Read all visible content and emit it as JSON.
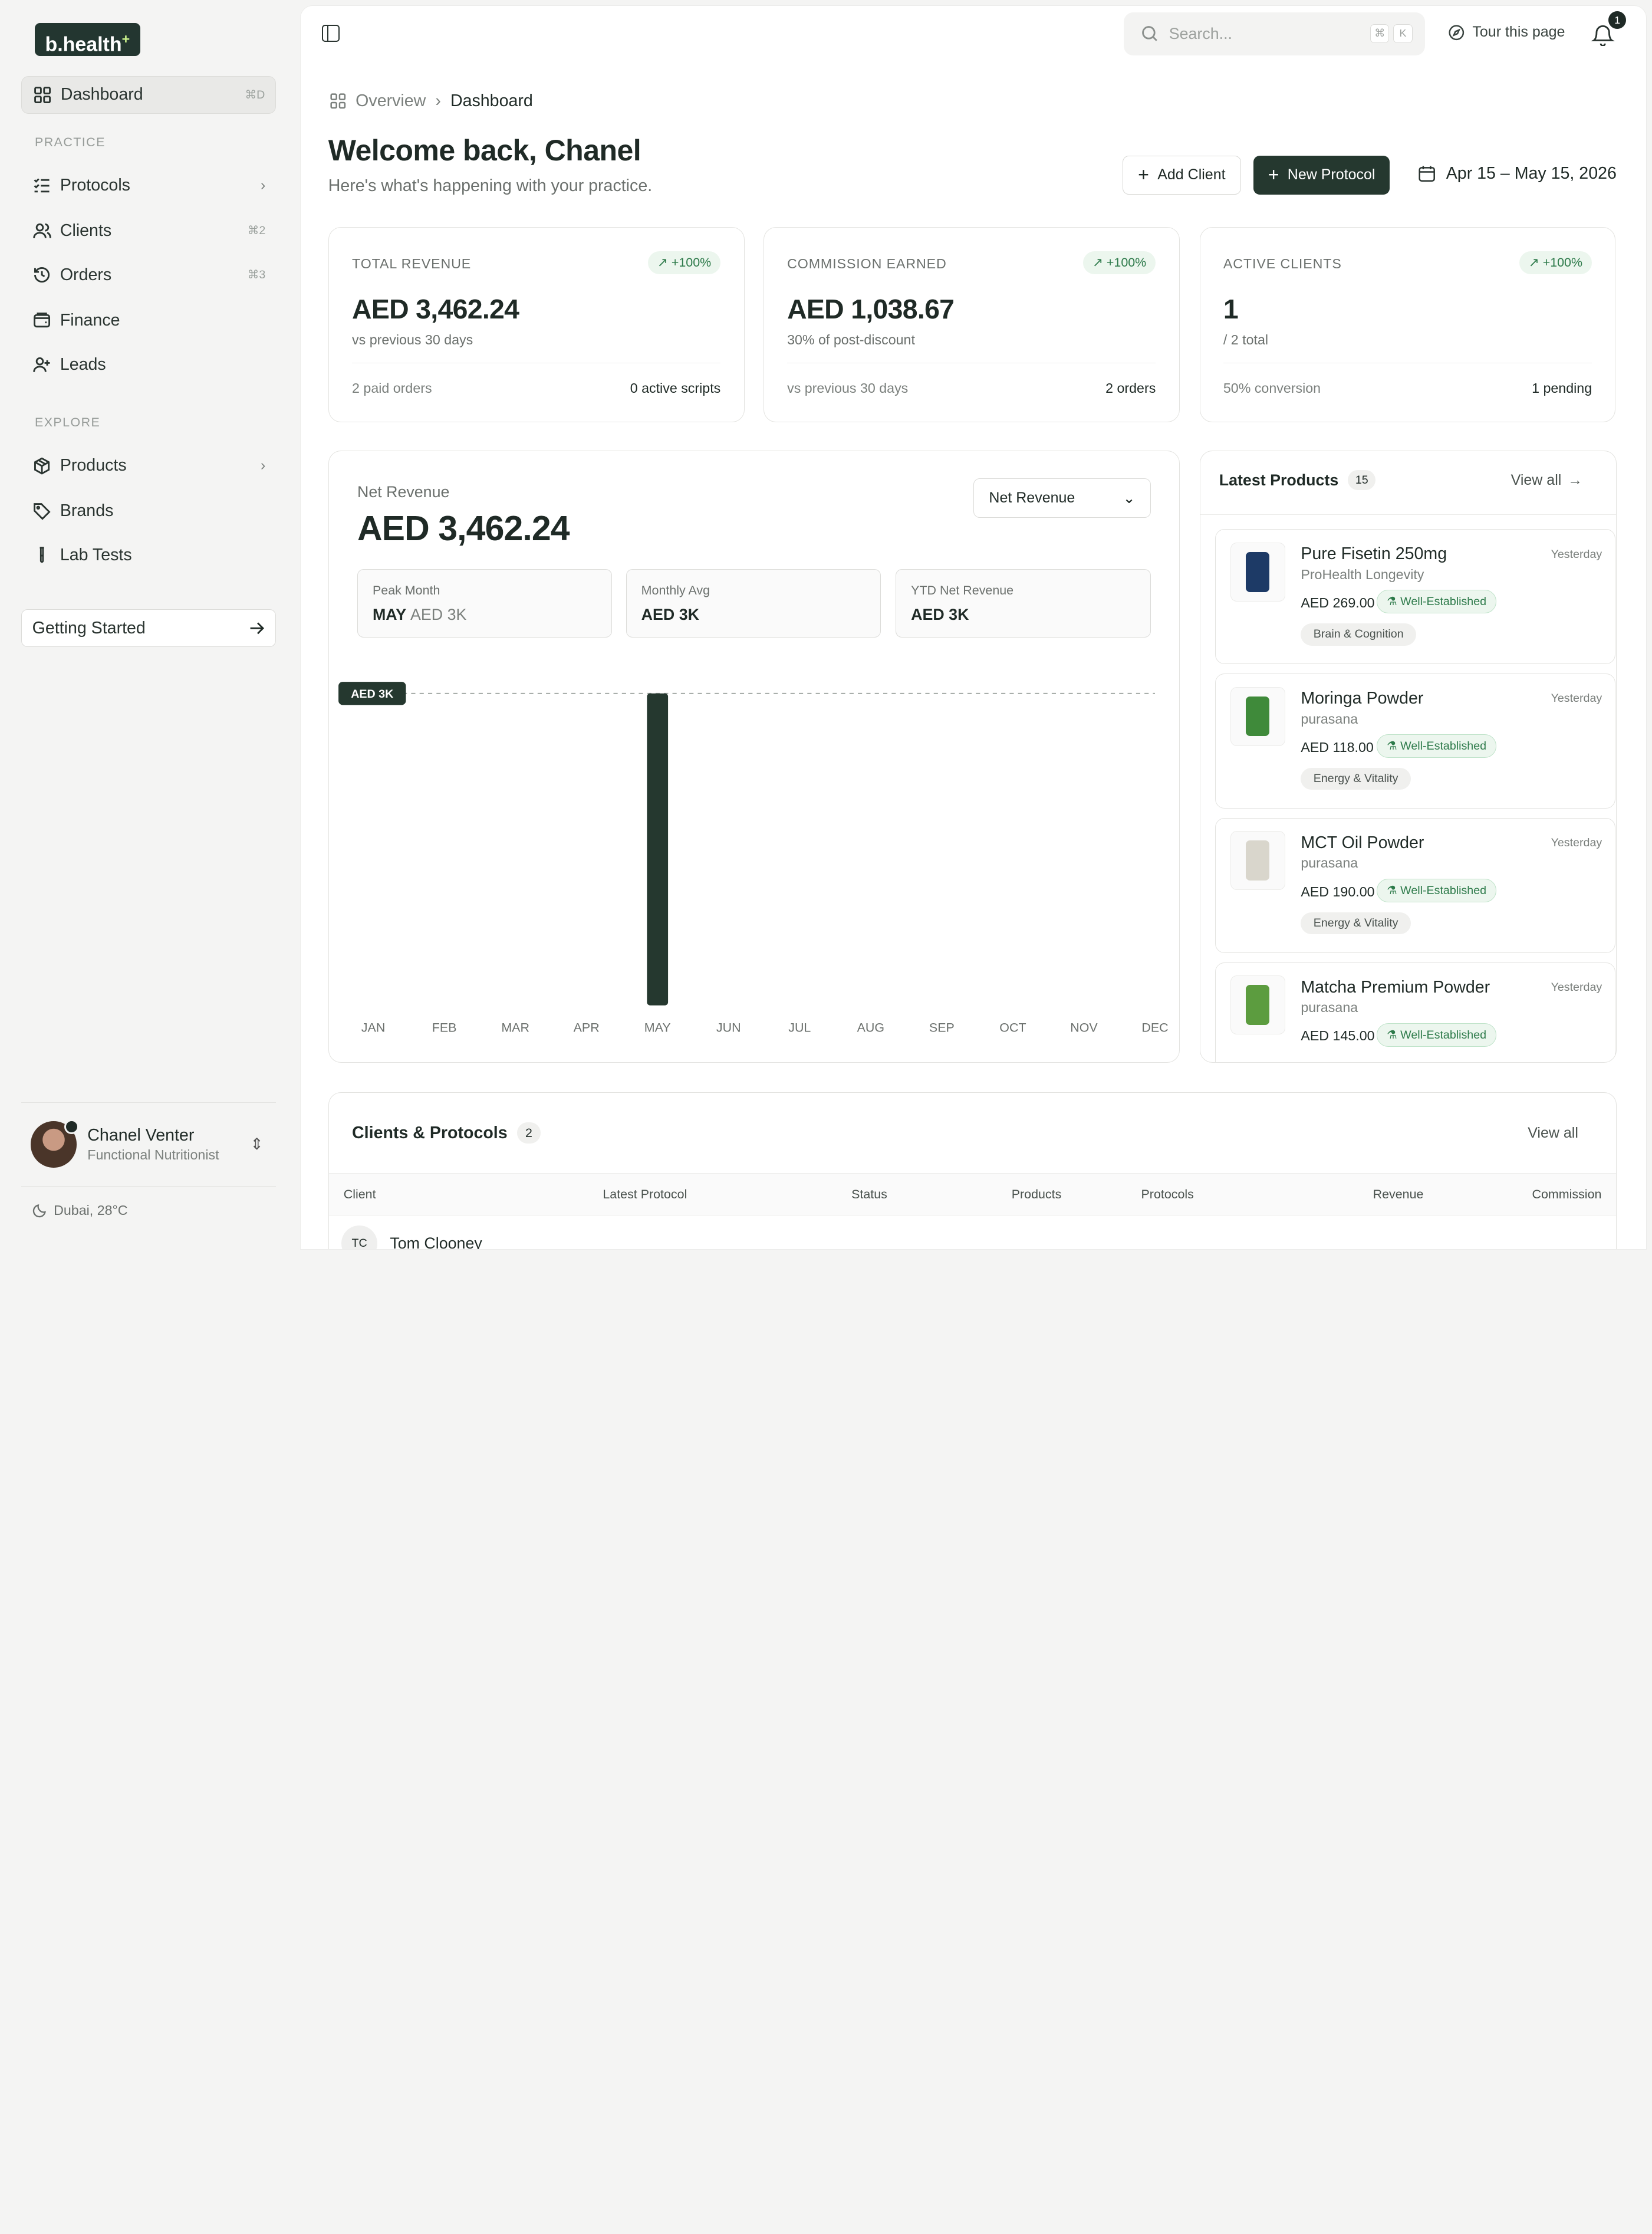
{
  "sidebar": {
    "logo": "b.health",
    "logo_mark": "+",
    "dashboard": {
      "label": "Dashboard",
      "shortcut": "⌘D"
    },
    "practice_heading": "PRACTICE",
    "practice_items": [
      {
        "label": "Protocols",
        "icon": "checklist-icon"
      },
      {
        "label": "Clients",
        "shortcut": "⌘2",
        "icon": "users-icon"
      },
      {
        "label": "Orders",
        "shortcut": "⌘3",
        "icon": "history-icon"
      },
      {
        "label": "Finance",
        "icon": "wallet-icon"
      },
      {
        "label": "Leads",
        "icon": "user-plus-icon"
      }
    ],
    "explore_heading": "EXPLORE",
    "explore_items": [
      {
        "label": "Products",
        "icon": "package-icon"
      },
      {
        "label": "Brands",
        "icon": "tag-icon"
      },
      {
        "label": "Lab Tests",
        "icon": "test-tube-icon"
      }
    ],
    "getting_started": "Getting Started",
    "user": {
      "name": "Chanel Venter",
      "role": "Functional Nutritionist"
    },
    "weather": "Dubai, 28°C"
  },
  "topbar": {
    "search_placeholder": "Search...",
    "search_keys": [
      "⌘",
      "K"
    ],
    "tour": "Tour this page",
    "notifications": "1"
  },
  "breadcrumb": {
    "root": "Overview",
    "current": "Dashboard"
  },
  "header": {
    "title": "Welcome back, Chanel",
    "subtitle": "Here's what's happening with your practice.",
    "add_client": "Add Client",
    "new_protocol": "New Protocol",
    "date_range": "Apr 15 – May 15, 2026"
  },
  "stats": [
    {
      "label": "TOTAL REVENUE",
      "badge": "+100%",
      "value": "AED 3,462.24",
      "sub": "vs previous 30 days",
      "foot_left": "2 paid orders",
      "foot_right": "0 active scripts"
    },
    {
      "label": "COMMISSION EARNED",
      "badge": "+100%",
      "value": "AED 1,038.67",
      "sub": "30% of post-discount",
      "foot_left": "vs previous 30 days",
      "foot_right": "2 orders"
    },
    {
      "label": "ACTIVE CLIENTS",
      "badge": "+100%",
      "value": "1",
      "sub": "/ 2 total",
      "foot_left": "50% conversion",
      "foot_right": "1 pending"
    }
  ],
  "revenue": {
    "label": "Net Revenue",
    "value": "AED 3,462.24",
    "select": "Net Revenue",
    "peak_label": "Peak Month",
    "peak_month": "MAY",
    "peak_value": "AED 3K",
    "avg_label": "Monthly Avg",
    "avg_value": "AED 3K",
    "ytd_label": "YTD Net Revenue",
    "ytd_value": "AED 3K"
  },
  "chart_data": {
    "type": "bar",
    "categories": [
      "JAN",
      "FEB",
      "MAR",
      "APR",
      "MAY",
      "JUN",
      "JUL",
      "AUG",
      "SEP",
      "OCT",
      "NOV",
      "DEC"
    ],
    "values": [
      0,
      0,
      0,
      0,
      3462.24,
      0,
      0,
      0,
      0,
      0,
      0,
      0
    ],
    "reference_label": "AED 3K",
    "bar_color": "#25382f"
  },
  "products": {
    "title": "Latest Products",
    "count": "15",
    "view_all": "View all",
    "items": [
      {
        "name": "Pure Fisetin 250mg",
        "brand": "ProHealth Longevity",
        "time": "Yesterday",
        "price": "AED 269.00",
        "evidence": "Well-Established",
        "tag": "Brain & Cognition",
        "color": "#1d3a66"
      },
      {
        "name": "Moringa Powder",
        "brand": "purasana",
        "time": "Yesterday",
        "price": "AED 118.00",
        "evidence": "Well-Established",
        "tag": "Energy & Vitality",
        "color": "#3f8a3a"
      },
      {
        "name": "MCT Oil Powder",
        "brand": "purasana",
        "time": "Yesterday",
        "price": "AED 190.00",
        "evidence": "Well-Established",
        "tag": "Energy & Vitality",
        "color": "#d9d6cc"
      },
      {
        "name": "Matcha Premium Powder",
        "brand": "purasana",
        "time": "Yesterday",
        "price": "AED 145.00",
        "evidence": "Well-Established",
        "tag": "",
        "color": "#5c9c3f"
      }
    ]
  },
  "clients": {
    "title": "Clients & Protocols",
    "count": "2",
    "view_all": "View all",
    "columns": [
      "Client",
      "Latest Protocol",
      "Status",
      "Products",
      "Protocols",
      "Revenue",
      "Commission"
    ],
    "rows": [
      {
        "initials": "TC",
        "name": "Tom Clooney"
      }
    ]
  }
}
